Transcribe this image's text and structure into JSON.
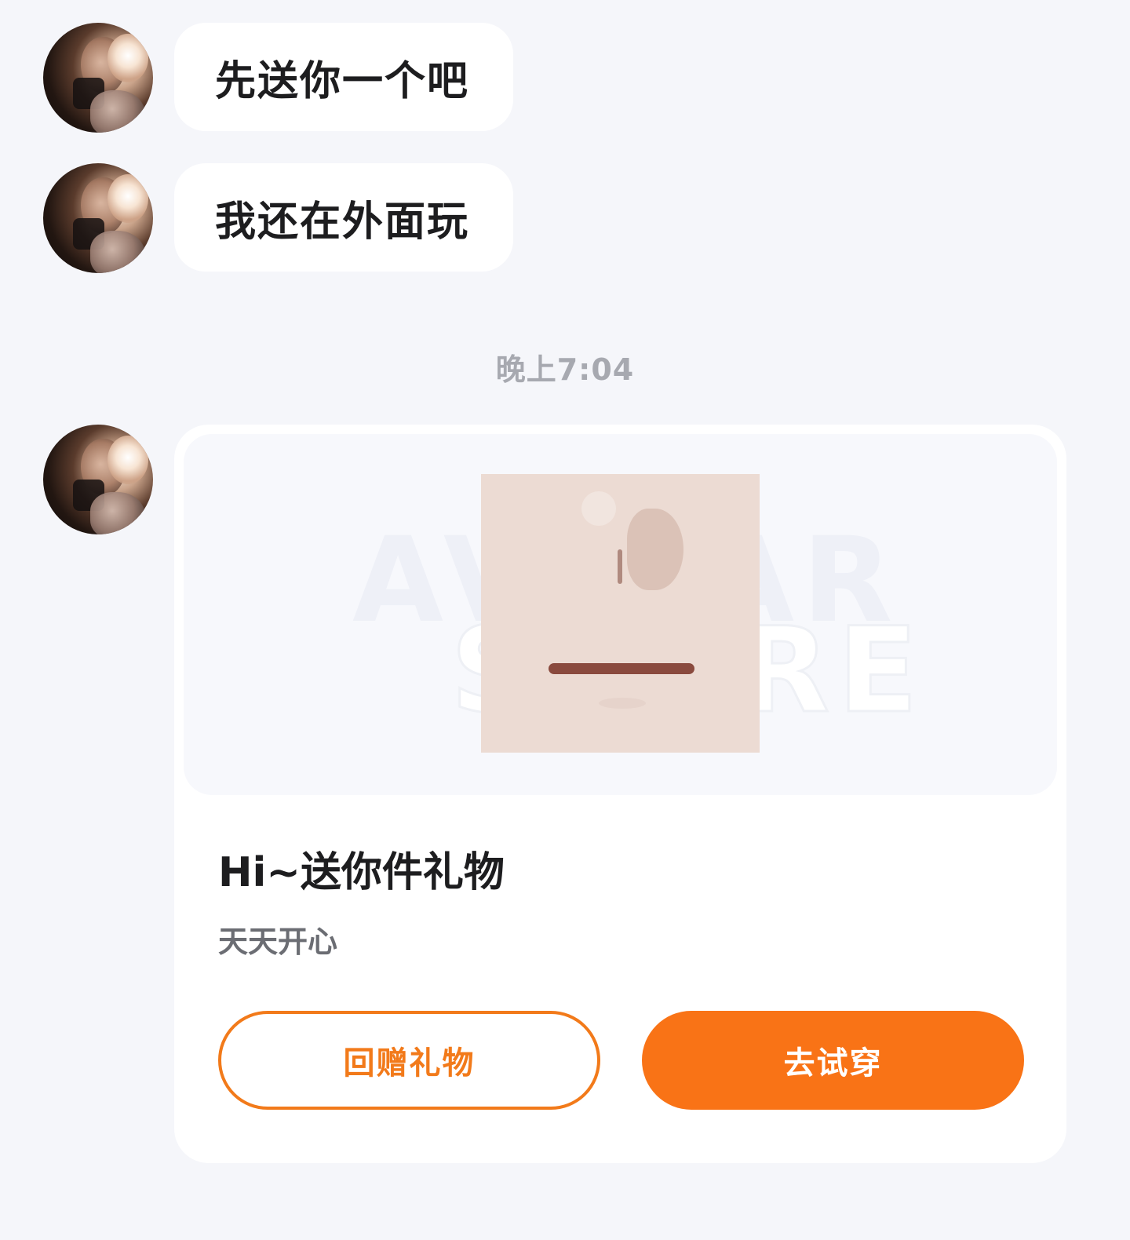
{
  "messages": [
    {
      "text": "先送你一个吧"
    },
    {
      "text": "我还在外面玩"
    }
  ],
  "timestamp": "晚上7:04",
  "gift_card": {
    "title": "Hi~送你件礼物",
    "subtitle": "天天开心",
    "watermark_line1": "AVATAR",
    "watermark_line2": "STORE",
    "return_gift_label": "回赠礼物",
    "try_on_label": "去试穿"
  },
  "colors": {
    "accent": "#f97316",
    "background": "#f5f6fa",
    "bubble": "#ffffff",
    "timestamp": "#a7a9b0"
  }
}
